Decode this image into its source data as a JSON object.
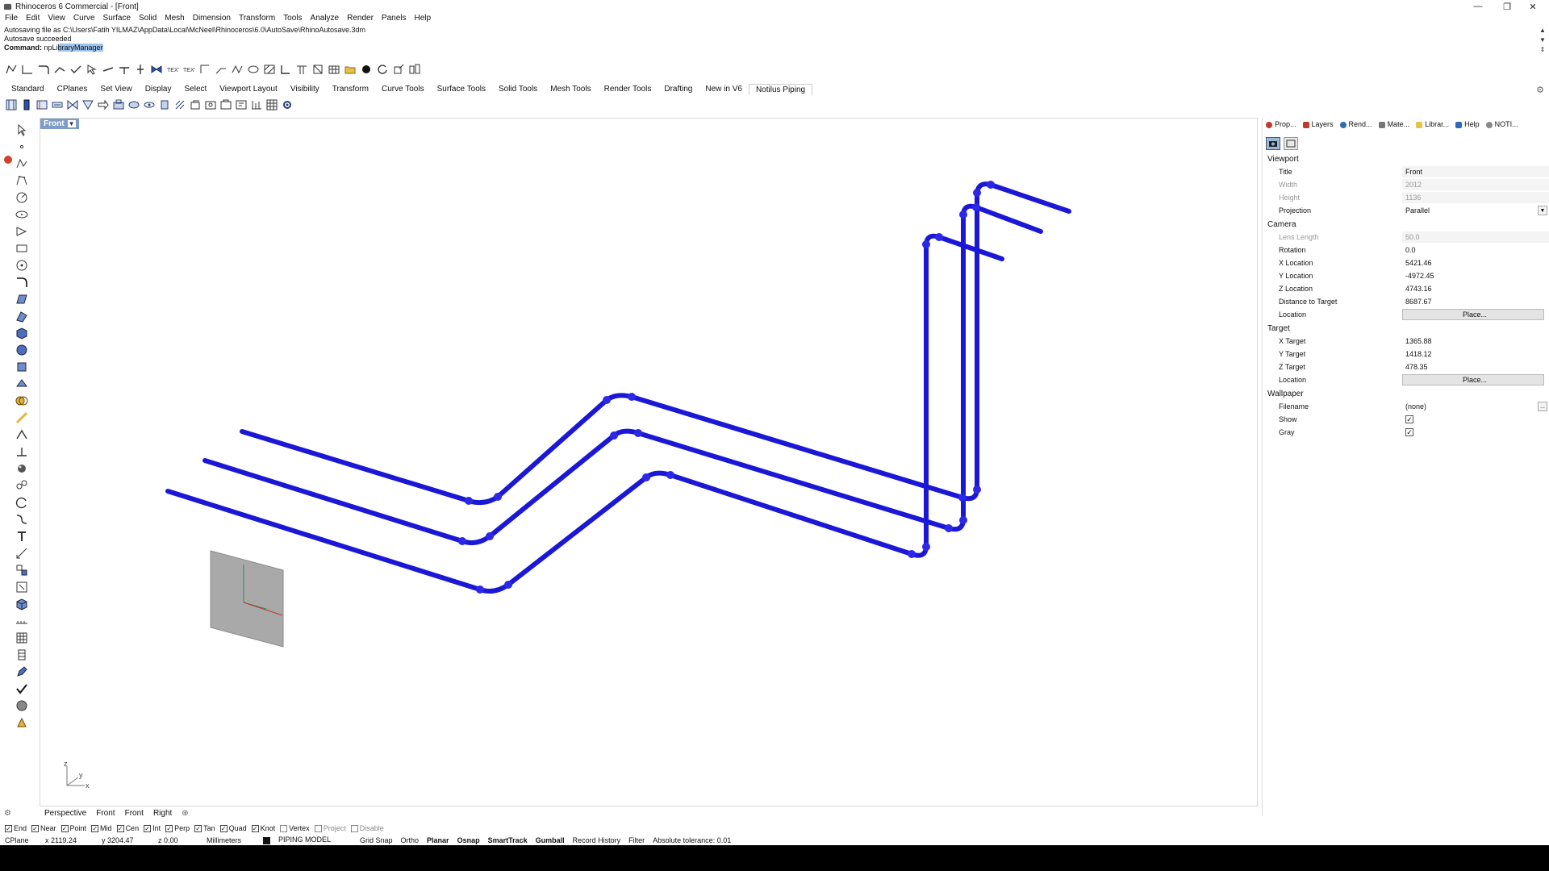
{
  "title": "Rhinoceros 6 Commercial - [Front]",
  "menu": [
    "File",
    "Edit",
    "View",
    "Curve",
    "Surface",
    "Solid",
    "Mesh",
    "Dimension",
    "Transform",
    "Tools",
    "Analyze",
    "Render",
    "Panels",
    "Help"
  ],
  "command_history": {
    "line1": "Autosaving file as C:\\Users\\Fatih YILMAZ\\AppData\\Local\\McNeel\\Rhinoceros\\6.0\\AutoSave\\RhinoAutosave.3dm",
    "line2": "Autosave succeeded",
    "prompt_label": "Command:",
    "prompt_typed": "npLi",
    "prompt_autocomplete": "braryManager"
  },
  "toolbar_tabs": [
    "Standard",
    "CPlanes",
    "Set View",
    "Display",
    "Select",
    "Viewport Layout",
    "Visibility",
    "Transform",
    "Curve Tools",
    "Surface Tools",
    "Solid Tools",
    "Mesh Tools",
    "Render Tools",
    "Drafting",
    "New in V6",
    "Notilus Piping"
  ],
  "active_toolbar_tab": "Notilus Piping",
  "viewport": {
    "label": "Front",
    "axis_labels": {
      "z": "z",
      "y": "y",
      "x": "x"
    }
  },
  "viewport_tabs": [
    "Perspective",
    "Front",
    "Front",
    "Right"
  ],
  "panel": {
    "tabs": [
      "Prop...",
      "Layers",
      "Rend...",
      "Mate...",
      "Librar...",
      "Help",
      "NOTI..."
    ],
    "sections": {
      "viewport": {
        "heading": "Viewport",
        "rows": [
          {
            "key": "Title",
            "value": "Front"
          },
          {
            "key": "Width",
            "value": "2012"
          },
          {
            "key": "Height",
            "value": "1136"
          },
          {
            "key": "Projection",
            "value": "Parallel"
          }
        ]
      },
      "camera": {
        "heading": "Camera",
        "rows": [
          {
            "key": "Lens Length",
            "value": "50.0"
          },
          {
            "key": "Rotation",
            "value": "0.0"
          },
          {
            "key": "X Location",
            "value": "5421.46"
          },
          {
            "key": "Y Location",
            "value": "-4972.45"
          },
          {
            "key": "Z Location",
            "value": "4743.16"
          },
          {
            "key": "Distance to Target",
            "value": "8687.67"
          },
          {
            "key": "Location",
            "value": "Place..."
          }
        ]
      },
      "target": {
        "heading": "Target",
        "rows": [
          {
            "key": "X Target",
            "value": "1365.88"
          },
          {
            "key": "Y Target",
            "value": "1418.12"
          },
          {
            "key": "Z Target",
            "value": "478.35"
          },
          {
            "key": "Location",
            "value": "Place..."
          }
        ]
      },
      "wallpaper": {
        "heading": "Wallpaper",
        "rows": [
          {
            "key": "Filename",
            "value": "(none)"
          },
          {
            "key": "Show",
            "value": "✓"
          },
          {
            "key": "Gray",
            "value": "✓"
          }
        ]
      }
    }
  },
  "osnaps": [
    {
      "label": "End",
      "checked": true
    },
    {
      "label": "Near",
      "checked": true
    },
    {
      "label": "Point",
      "checked": true
    },
    {
      "label": "Mid",
      "checked": true
    },
    {
      "label": "Cen",
      "checked": true
    },
    {
      "label": "Int",
      "checked": true
    },
    {
      "label": "Perp",
      "checked": true
    },
    {
      "label": "Tan",
      "checked": true
    },
    {
      "label": "Quad",
      "checked": true
    },
    {
      "label": "Knot",
      "checked": true
    },
    {
      "label": "Vertex",
      "checked": false
    },
    {
      "label": "Project",
      "checked": false
    },
    {
      "label": "Disable",
      "checked": false
    }
  ],
  "status": {
    "cplane": "CPlane",
    "x": "x 2119.24",
    "y": "y 3204.47",
    "z": "z 0.00",
    "units": "Millimeters",
    "layer": "PIPING MODEL",
    "toggles": [
      "Grid Snap",
      "Ortho",
      "Planar",
      "Osnap",
      "SmartTrack",
      "Gumball",
      "Record History",
      "Filter"
    ],
    "bold_toggles": [
      "Planar",
      "Osnap",
      "SmartTrack",
      "Gumball"
    ],
    "tolerance": "Absolute tolerance: 0.01"
  },
  "colors": {
    "pipe": "#1a17d6",
    "viewport_label_bg": "#7d9dc4",
    "plane_fill": "#a9a9a9"
  }
}
